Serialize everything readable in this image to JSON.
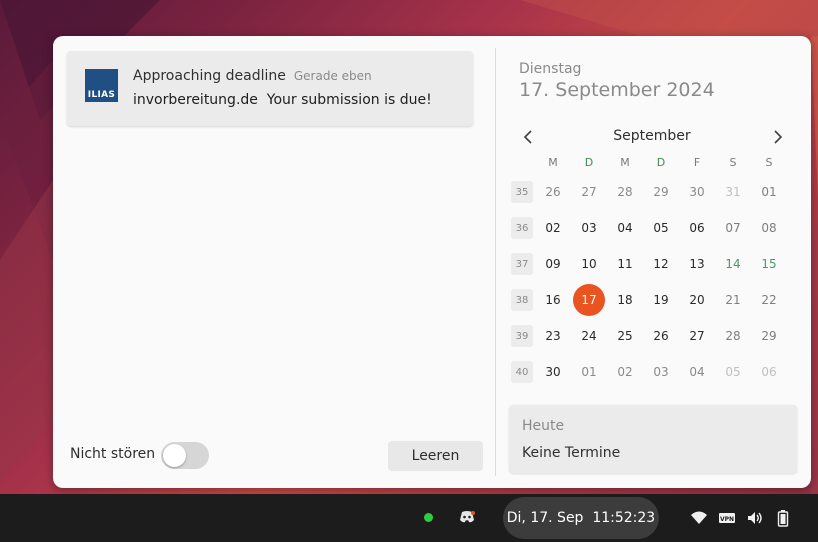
{
  "notification": {
    "app_logo_text": "ILIAS",
    "title": "Approaching deadline",
    "time": "Gerade eben",
    "body": "invorbereitung.de  Your submission is due!"
  },
  "dnd": {
    "label": "Nicht stören",
    "enabled": false
  },
  "clear_button": "Leeren",
  "calendar": {
    "weekday": "Dienstag",
    "full_date": "17. September 2024",
    "month": "September",
    "day_headers": [
      "M",
      "D",
      "M",
      "D",
      "F",
      "S",
      "S"
    ],
    "weeks": [
      {
        "num": "35",
        "days": [
          "26",
          "27",
          "28",
          "29",
          "30",
          "31",
          "01"
        ]
      },
      {
        "num": "36",
        "days": [
          "02",
          "03",
          "04",
          "05",
          "06",
          "07",
          "08"
        ]
      },
      {
        "num": "37",
        "days": [
          "09",
          "10",
          "11",
          "12",
          "13",
          "14",
          "15"
        ]
      },
      {
        "num": "38",
        "days": [
          "16",
          "17",
          "18",
          "19",
          "20",
          "21",
          "22"
        ]
      },
      {
        "num": "39",
        "days": [
          "23",
          "24",
          "25",
          "26",
          "27",
          "28",
          "29"
        ]
      },
      {
        "num": "40",
        "days": [
          "30",
          "01",
          "02",
          "03",
          "04",
          "05",
          "06"
        ]
      }
    ],
    "today": "17"
  },
  "events": {
    "header": "Heute",
    "text": "Keine Termine"
  },
  "taskbar": {
    "clock": "Di, 17. Sep  11:52:23",
    "status_dot_color": "#2ecc40",
    "tray_icons": [
      "discord-icon",
      "wifi-icon",
      "vpn-icon",
      "volume-icon",
      "battery-icon"
    ]
  },
  "colors": {
    "accent": "#e95420"
  }
}
